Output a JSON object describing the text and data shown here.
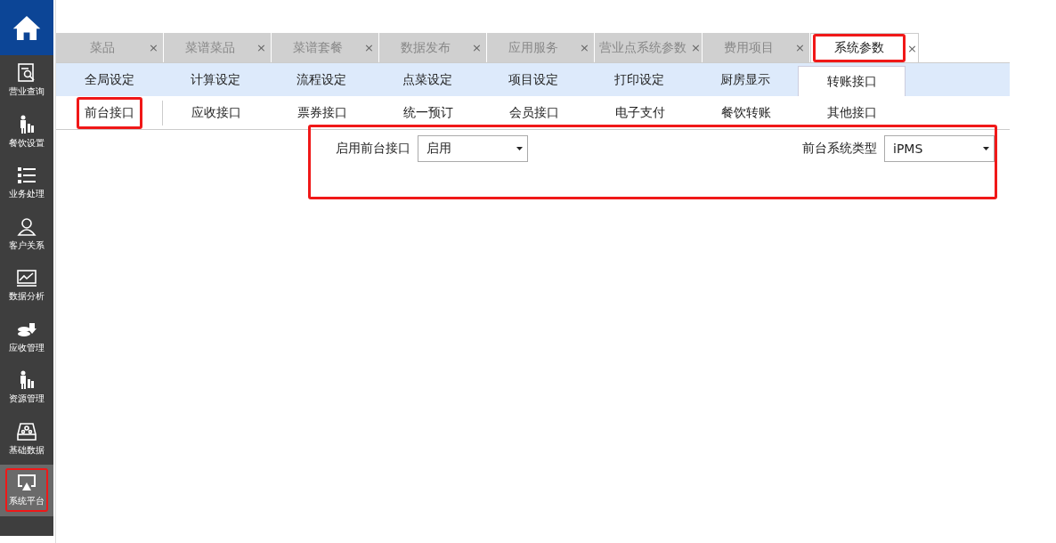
{
  "sidebar": {
    "items": [
      {
        "label": "营业查询",
        "selected": false,
        "highlighted": false
      },
      {
        "label": "餐饮设置",
        "selected": false,
        "highlighted": false
      },
      {
        "label": "业务处理",
        "selected": false,
        "highlighted": false
      },
      {
        "label": "客户关系",
        "selected": false,
        "highlighted": false
      },
      {
        "label": "数据分析",
        "selected": false,
        "highlighted": false
      },
      {
        "label": "应收管理",
        "selected": false,
        "highlighted": false
      },
      {
        "label": "资源管理",
        "selected": false,
        "highlighted": false
      },
      {
        "label": "基础数据",
        "selected": false,
        "highlighted": false
      },
      {
        "label": "系统平台",
        "selected": true,
        "highlighted": true
      }
    ]
  },
  "tabs": [
    {
      "label": "菜品",
      "close": "×",
      "selected": false,
      "highlighted": false
    },
    {
      "label": "菜谱菜品",
      "close": "×",
      "selected": false,
      "highlighted": false
    },
    {
      "label": "菜谱套餐",
      "close": "×",
      "selected": false,
      "highlighted": false
    },
    {
      "label": "数据发布",
      "close": "×",
      "selected": false,
      "highlighted": false
    },
    {
      "label": "应用服务",
      "close": "×",
      "selected": false,
      "highlighted": false
    },
    {
      "label": "营业点系统参数",
      "close": "×",
      "selected": false,
      "highlighted": false
    },
    {
      "label": "费用项目",
      "close": "×",
      "selected": false,
      "highlighted": false
    },
    {
      "label": "系统参数",
      "close": "×",
      "selected": true,
      "highlighted": true
    }
  ],
  "settings_tabs": [
    {
      "label": "全局设定",
      "selected": false
    },
    {
      "label": "计算设定",
      "selected": false
    },
    {
      "label": "流程设定",
      "selected": false
    },
    {
      "label": "点菜设定",
      "selected": false
    },
    {
      "label": "项目设定",
      "selected": false
    },
    {
      "label": "打印设定",
      "selected": false
    },
    {
      "label": "厨房显示",
      "selected": false
    },
    {
      "label": "转账接口",
      "selected": true
    }
  ],
  "interface_tabs": [
    {
      "label": "前台接口",
      "selected": true,
      "highlighted": true
    },
    {
      "label": "应收接口",
      "selected": false,
      "highlighted": false
    },
    {
      "label": "票券接口",
      "selected": false,
      "highlighted": false
    },
    {
      "label": "统一预订",
      "selected": false,
      "highlighted": false
    },
    {
      "label": "会员接口",
      "selected": false,
      "highlighted": false
    },
    {
      "label": "电子支付",
      "selected": false,
      "highlighted": false
    },
    {
      "label": "餐饮转账",
      "selected": false,
      "highlighted": false
    },
    {
      "label": "其他接口",
      "selected": false,
      "highlighted": false
    }
  ],
  "form": {
    "highlighted": true,
    "fields": [
      {
        "label": "启用前台接口",
        "value": "启用"
      },
      {
        "label": "前台系统类型",
        "value": "iPMS"
      }
    ]
  }
}
